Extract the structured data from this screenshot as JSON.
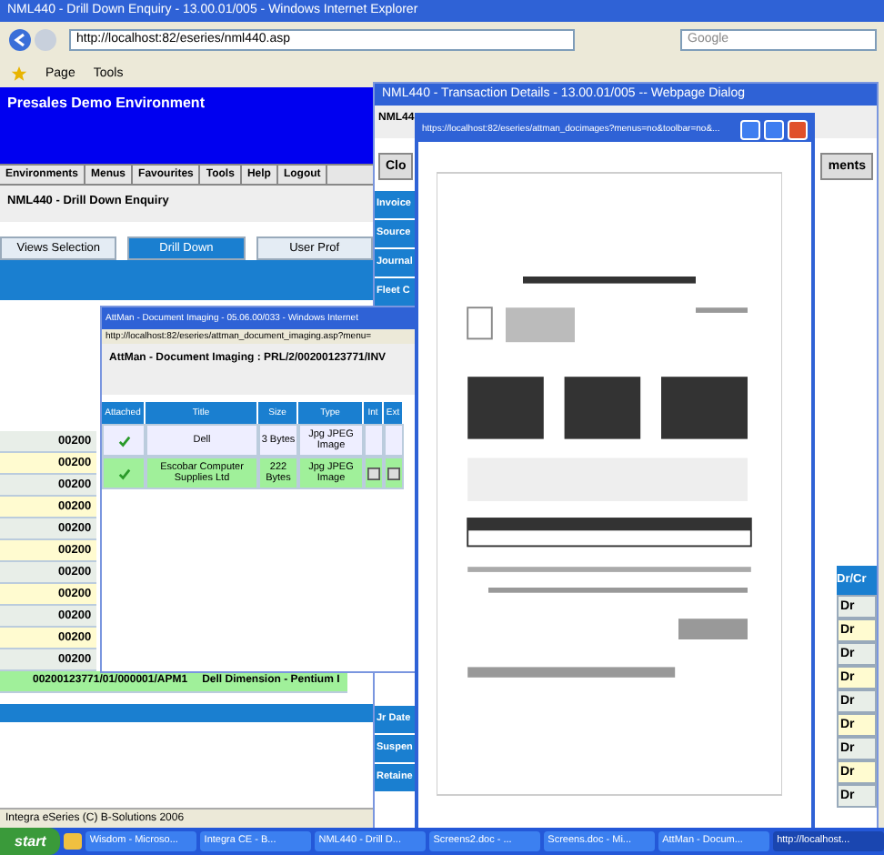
{
  "browser": {
    "title": "NML440 - Drill Down Enquiry - 13.00.01/005 - Windows Internet Explorer",
    "address": "http://localhost:82/eseries/nml440.asp",
    "search_placeholder": "Google",
    "toolbar": [
      "Page",
      "Tools"
    ]
  },
  "page": {
    "header": "Presales Demo Environment",
    "menu": [
      "Environments",
      "Menus",
      "Favourites",
      "Tools",
      "Help",
      "Logout"
    ],
    "heading": "NML440 - Drill Down Enquiry",
    "tabs": [
      {
        "label": "Views Selection",
        "selected": false
      },
      {
        "label": "Drill Down",
        "selected": true
      },
      {
        "label": "User Prof",
        "selected": false
      }
    ],
    "rows": [
      {
        "ref": "00200",
        "selected": false
      },
      {
        "ref": "00200",
        "selected": false
      },
      {
        "ref": "00200",
        "selected": false
      },
      {
        "ref": "00200",
        "selected": false
      },
      {
        "ref": "00200",
        "selected": false
      },
      {
        "ref": "00200",
        "selected": false
      },
      {
        "ref": "00200",
        "selected": false
      },
      {
        "ref": "00200",
        "selected": false
      },
      {
        "ref": "00200",
        "selected": false
      },
      {
        "ref": "00200",
        "selected": false
      },
      {
        "ref": "00200",
        "selected": false
      },
      {
        "ref": "00200123771/01/000001/APM1",
        "description": "Dell Dimension - Pentium I",
        "selected": true
      }
    ],
    "footer": "Integra eSeries (C) B-Solutions 2006"
  },
  "dialog": {
    "title": "NML440 - Transaction Details - 13.00.01/005 -- Webpage Dialog",
    "heading": "NML44",
    "close_button": "Clo",
    "attachments_button": "ments",
    "side_tabs": [
      "Invoice",
      "Source",
      "Journal",
      "Fleet C"
    ],
    "lower_tabs": [
      "Jr Date",
      "Suspen",
      "Retaine"
    ],
    "drcr_header": "Dr/Cr",
    "drcr": [
      "Dr",
      "Dr",
      "Dr",
      "Dr",
      "Dr",
      "Dr",
      "Dr",
      "Dr",
      "Dr"
    ]
  },
  "viewer": {
    "title": "https://localhost:82/eseries/attman_docimages?menus=no&toolbar=no&..."
  },
  "attman": {
    "title": "AttMan - Document Imaging - 05.06.00/033 - Windows Internet",
    "address": "http://localhost:82/eseries/attman_document_imaging.asp?menu=",
    "heading": "AttMan - Document Imaging : PRL/2/00200123771/INV",
    "columns": [
      "Attached",
      "Title",
      "Size",
      "Type",
      "Int",
      "Ext"
    ],
    "rows": [
      {
        "attached": true,
        "title": "Dell",
        "size": "3 Bytes",
        "type": "Jpg JPEG Image",
        "has_icons": false,
        "selected": false
      },
      {
        "attached": true,
        "title": "Escobar Computer Supplies Ltd",
        "size": "222 Bytes",
        "type": "Jpg JPEG Image",
        "has_icons": true,
        "selected": true
      }
    ]
  },
  "taskbar": {
    "start": "start",
    "tasks": [
      {
        "label": "Wisdom - Microso...",
        "active": false
      },
      {
        "label": "Integra CE - B...",
        "active": false
      },
      {
        "label": "NML440 - Drill D...",
        "active": false
      },
      {
        "label": "Screens2.doc - ...",
        "active": false
      },
      {
        "label": "Screens.doc - Mi...",
        "active": false
      },
      {
        "label": "AttMan - Docum...",
        "active": false
      },
      {
        "label": "http://localhost...",
        "active": true
      }
    ]
  }
}
